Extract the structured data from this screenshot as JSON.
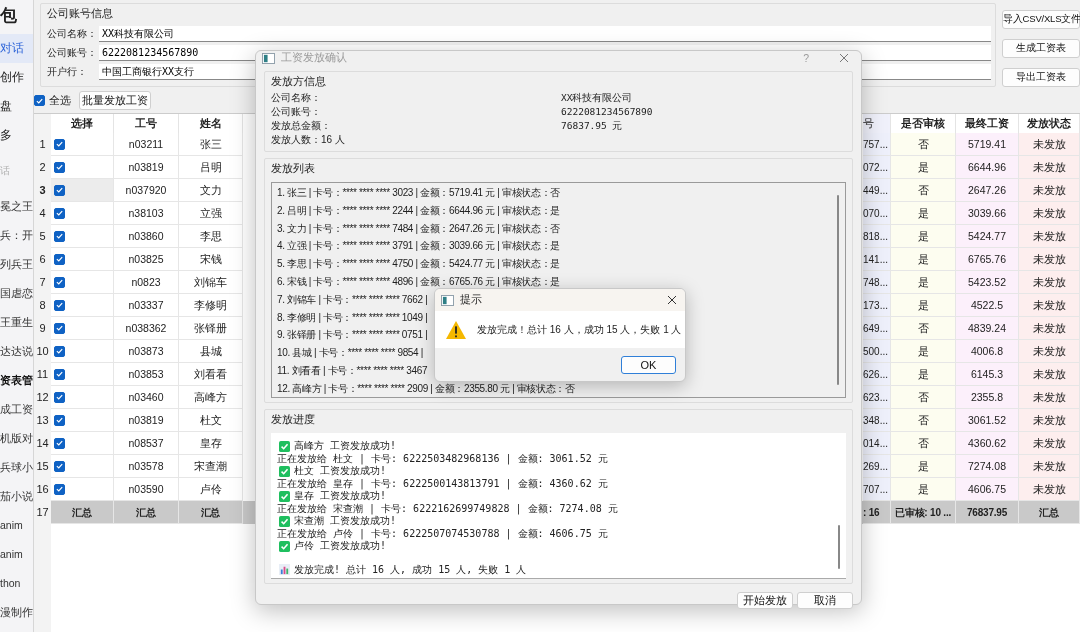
{
  "sidebar": {
    "title": "包",
    "nav": [
      {
        "label": "对话",
        "selected": true
      },
      {
        "label": "创作",
        "selected": false
      },
      {
        "label": "盘",
        "selected": false
      },
      {
        "label": "多",
        "selected": false
      }
    ],
    "section": "话",
    "history": [
      {
        "label": "冕之王",
        "selected": false
      },
      {
        "label": "兵：开",
        "selected": false
      },
      {
        "label": "列兵王",
        "selected": false
      },
      {
        "label": "国虐恋",
        "selected": false
      },
      {
        "label": "王重生",
        "selected": false
      },
      {
        "label": "达达说",
        "selected": false
      },
      {
        "label": "资表管",
        "selected": true
      },
      {
        "label": "成工资",
        "selected": false
      },
      {
        "label": "机版对",
        "selected": false
      },
      {
        "label": "兵球小",
        "selected": false
      },
      {
        "label": "茄小说",
        "selected": false
      },
      {
        "label": "anim",
        "selected": false
      },
      {
        "label": "anim",
        "selected": false
      },
      {
        "label": "thon",
        "selected": false
      },
      {
        "label": "漫制作",
        "selected": false
      }
    ]
  },
  "company": {
    "title": "公司账号信息",
    "fields": [
      {
        "label": "公司名称：",
        "value": "XX科技有限公司"
      },
      {
        "label": "公司账号：",
        "value": "6222081234567890"
      },
      {
        "label": "开户行：",
        "value": "中国工商银行XX支行"
      }
    ]
  },
  "side_buttons": [
    "导入CSV/XLS文件",
    "生成工资表",
    "导出工资表"
  ],
  "select_all": {
    "label": "全选",
    "checked": true
  },
  "batch_button": "批量发放工资",
  "table": {
    "left_columns": [
      "选择",
      "工号",
      "姓名"
    ],
    "right_columns": [
      "号",
      "是否审核",
      "最终工资",
      "发放状态"
    ],
    "rows": [
      {
        "number": "1",
        "selected": false,
        "checked": true,
        "id": "n03211",
        "name": "张三",
        "card": "757...",
        "audited": "否",
        "wage": "5719.41",
        "status": "未发放"
      },
      {
        "number": "2",
        "selected": false,
        "checked": true,
        "id": "n03819",
        "name": "吕明",
        "card": "072...",
        "audited": "是",
        "wage": "6644.96",
        "status": "未发放"
      },
      {
        "number": "3",
        "selected": true,
        "checked": true,
        "id": "n037920",
        "name": "文力",
        "card": "449...",
        "audited": "否",
        "wage": "2647.26",
        "status": "未发放"
      },
      {
        "number": "4",
        "selected": false,
        "checked": true,
        "id": "n38103",
        "name": "立强",
        "card": "070...",
        "audited": "是",
        "wage": "3039.66",
        "status": "未发放"
      },
      {
        "number": "5",
        "selected": false,
        "checked": true,
        "id": "n03860",
        "name": "李思",
        "card": "818...",
        "audited": "是",
        "wage": "5424.77",
        "status": "未发放"
      },
      {
        "number": "6",
        "selected": false,
        "checked": true,
        "id": "n03825",
        "name": "宋钱",
        "card": "141...",
        "audited": "是",
        "wage": "6765.76",
        "status": "未发放"
      },
      {
        "number": "7",
        "selected": false,
        "checked": true,
        "id": "n0823",
        "name": "刘锦车",
        "card": "748...",
        "audited": "是",
        "wage": "5423.52",
        "status": "未发放"
      },
      {
        "number": "8",
        "selected": false,
        "checked": true,
        "id": "n03337",
        "name": "李修明",
        "card": "173...",
        "audited": "是",
        "wage": "4522.5",
        "status": "未发放"
      },
      {
        "number": "9",
        "selected": false,
        "checked": true,
        "id": "n038362",
        "name": "张铎册",
        "card": "649...",
        "audited": "否",
        "wage": "4839.24",
        "status": "未发放"
      },
      {
        "number": "10",
        "selected": false,
        "checked": true,
        "id": "n03873",
        "name": "县城",
        "card": "500...",
        "audited": "是",
        "wage": "4006.8",
        "status": "未发放"
      },
      {
        "number": "11",
        "selected": false,
        "checked": true,
        "id": "n03853",
        "name": "刘看看",
        "card": "626...",
        "audited": "是",
        "wage": "6145.3",
        "status": "未发放"
      },
      {
        "number": "12",
        "selected": false,
        "checked": true,
        "id": "n03460",
        "name": "高峰方",
        "card": "623...",
        "audited": "否",
        "wage": "2355.8",
        "status": "未发放"
      },
      {
        "number": "13",
        "selected": false,
        "checked": true,
        "id": "n03819",
        "name": "杜文",
        "card": "348...",
        "audited": "否",
        "wage": "3061.52",
        "status": "未发放"
      },
      {
        "number": "14",
        "selected": false,
        "checked": true,
        "id": "n08537",
        "name": "皇存",
        "card": "014...",
        "audited": "否",
        "wage": "4360.62",
        "status": "未发放"
      },
      {
        "number": "15",
        "selected": false,
        "checked": true,
        "id": "n03578",
        "name": "宋查潮",
        "card": "269...",
        "audited": "是",
        "wage": "7274.08",
        "status": "未发放"
      },
      {
        "number": "16",
        "selected": false,
        "checked": true,
        "id": "n03590",
        "name": "卢伶",
        "card": "707...",
        "audited": "是",
        "wage": "4606.75",
        "status": "未发放"
      }
    ],
    "summary": {
      "number": "17",
      "left": [
        "汇总",
        "汇总",
        "汇总"
      ],
      "card": ": 16",
      "audited": "已审核: 10 ...",
      "wage": "76837.95",
      "status": "汇总"
    }
  },
  "dialog": {
    "title": "工资发放确认",
    "help": "?",
    "payer": {
      "title": "发放方信息",
      "rows": [
        {
          "label": "公司名称：",
          "value": "XX科技有限公司"
        },
        {
          "label": "公司账号：",
          "value": "6222081234567890"
        },
        {
          "label": "发放总金额：",
          "value": "76837.95 元"
        }
      ],
      "count": "发放人数：16 人"
    },
    "list": {
      "title": "发放列表",
      "items": [
        "1. 张三 | 卡号：**** **** **** 3023 | 金额：5719.41 元 | 审核状态：否",
        "2. 吕明 | 卡号：**** **** **** 2244 | 金额：6644.96 元 | 审核状态：是",
        "3. 文力 | 卡号：**** **** **** 7484 | 金额：2647.26 元 | 审核状态：否",
        "4. 立强 | 卡号：**** **** **** 3791 | 金额：3039.66 元 | 审核状态：是",
        "5. 李思 | 卡号：**** **** **** 4750 | 金额：5424.77 元 | 审核状态：是",
        "6. 宋钱 | 卡号：**** **** **** 4896 | 金额：6765.76 元 | 审核状态：是",
        "7. 刘锦车 | 卡号：**** **** **** 7662 |",
        "8. 李修明 | 卡号：**** **** **** 1049 |",
        "9. 张铎册 | 卡号：**** **** **** 0751 |",
        "10. 县城 | 卡号：**** **** **** 9854 |",
        "11. 刘看看 | 卡号：**** **** **** 3467",
        "12. 高峰方 | 卡号：**** **** **** 2909 | 金额：2355.80 元 | 审核状态：否"
      ]
    },
    "progress": {
      "title": "发放进度",
      "log": [
        {
          "kind": "success",
          "text": "高峰方 工资发放成功!"
        },
        {
          "kind": "progress",
          "text": "正在发放给 杜文 | 卡号: 6222503482968136 | 金额: 3061.52 元"
        },
        {
          "kind": "success",
          "text": "杜文 工资发放成功!"
        },
        {
          "kind": "progress",
          "text": "正在发放给 皇存 | 卡号: 6222500143813791 | 金额: 4360.62 元"
        },
        {
          "kind": "success",
          "text": "皇存 工资发放成功!"
        },
        {
          "kind": "progress",
          "text": "正在发放给 宋查潮 | 卡号: 6222162699749828 | 金额: 7274.08 元"
        },
        {
          "kind": "success",
          "text": "宋查潮 工资发放成功!"
        },
        {
          "kind": "progress",
          "text": "正在发放给 卢伶 | 卡号: 6222507074530788 | 金额: 4606.75 元"
        },
        {
          "kind": "success",
          "text": "卢伶 工资发放成功!"
        },
        {
          "kind": "summary",
          "text": "发放完成! 总计 16 人, 成功 15 人, 失败 1 人"
        }
      ]
    },
    "buttons": [
      "开始发放",
      "取消"
    ]
  },
  "message_box": {
    "title": "提示",
    "text": "发放完成！总计 16 人，成功 15 人，失败 1 人",
    "button": "OK"
  }
}
